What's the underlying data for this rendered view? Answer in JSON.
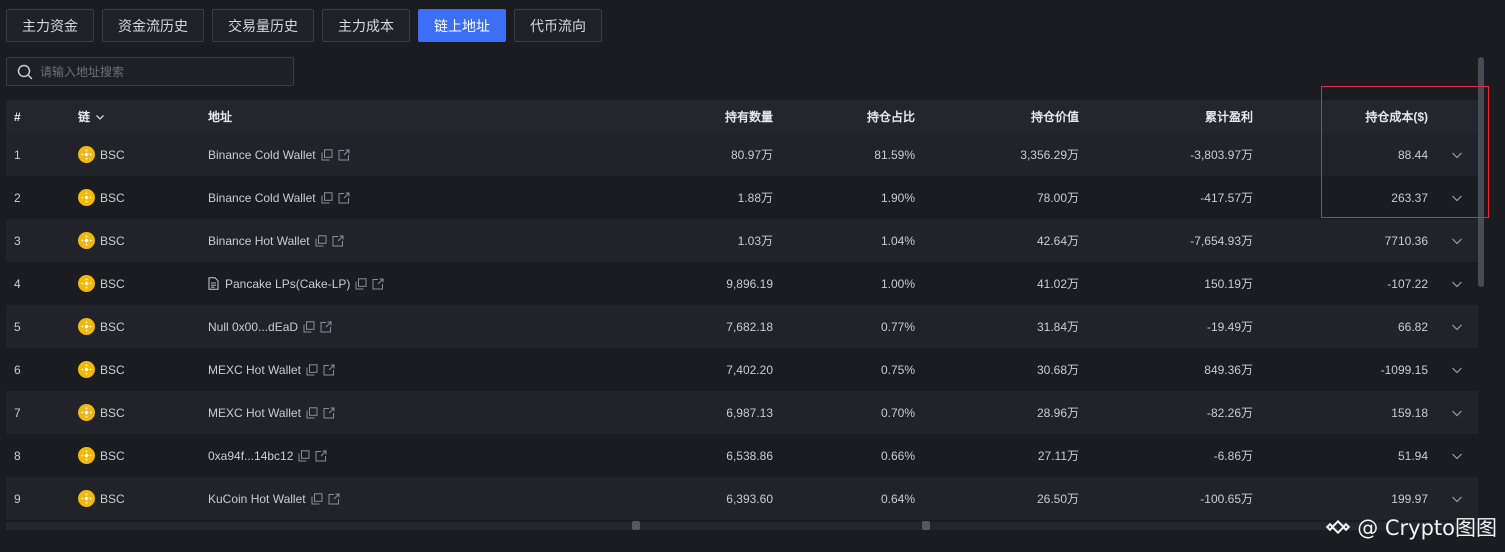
{
  "tabs": [
    {
      "label": "主力资金",
      "active": false
    },
    {
      "label": "资金流历史",
      "active": false
    },
    {
      "label": "交易量历史",
      "active": false
    },
    {
      "label": "主力成本",
      "active": false
    },
    {
      "label": "链上地址",
      "active": true
    },
    {
      "label": "代币流向",
      "active": false
    }
  ],
  "search": {
    "placeholder": "请输入地址搜索",
    "icon": "search-icon"
  },
  "table": {
    "headers": {
      "num": "#",
      "chain": "链",
      "address": "地址",
      "quantity": "持有数量",
      "percent": "持仓占比",
      "value": "持仓价值",
      "pnl": "累计盈利",
      "cost": "持仓成本($)"
    },
    "rows": [
      {
        "num": "1",
        "chain": "BSC",
        "address": "Binance Cold Wallet",
        "contract": false,
        "quantity": "80.97万",
        "percent": "81.59%",
        "value": "3,356.29万",
        "pnl": "-3,803.97万",
        "cost": "88.44"
      },
      {
        "num": "2",
        "chain": "BSC",
        "address": "Binance Cold Wallet",
        "contract": false,
        "quantity": "1.88万",
        "percent": "1.90%",
        "value": "78.00万",
        "pnl": "-417.57万",
        "cost": "263.37"
      },
      {
        "num": "3",
        "chain": "BSC",
        "address": "Binance Hot Wallet",
        "contract": false,
        "quantity": "1.03万",
        "percent": "1.04%",
        "value": "42.64万",
        "pnl": "-7,654.93万",
        "cost": "7710.36"
      },
      {
        "num": "4",
        "chain": "BSC",
        "address": "Pancake LPs(Cake-LP)",
        "contract": true,
        "quantity": "9,896.19",
        "percent": "1.00%",
        "value": "41.02万",
        "pnl": "150.19万",
        "cost": "-107.22"
      },
      {
        "num": "5",
        "chain": "BSC",
        "address": "Null 0x00...dEaD",
        "contract": false,
        "quantity": "7,682.18",
        "percent": "0.77%",
        "value": "31.84万",
        "pnl": "-19.49万",
        "cost": "66.82"
      },
      {
        "num": "6",
        "chain": "BSC",
        "address": "MEXC Hot Wallet",
        "contract": false,
        "quantity": "7,402.20",
        "percent": "0.75%",
        "value": "30.68万",
        "pnl": "849.36万",
        "cost": "-1099.15"
      },
      {
        "num": "7",
        "chain": "BSC",
        "address": "MEXC Hot Wallet",
        "contract": false,
        "quantity": "6,987.13",
        "percent": "0.70%",
        "value": "28.96万",
        "pnl": "-82.26万",
        "cost": "159.18"
      },
      {
        "num": "8",
        "chain": "BSC",
        "address": "0xa94f...14bc12",
        "contract": false,
        "quantity": "6,538.86",
        "percent": "0.66%",
        "value": "27.11万",
        "pnl": "-6.86万",
        "cost": "51.94"
      },
      {
        "num": "9",
        "chain": "BSC",
        "address": "KuCoin Hot Wallet",
        "contract": false,
        "quantity": "6,393.60",
        "percent": "0.64%",
        "value": "26.50万",
        "pnl": "-100.65万",
        "cost": "199.97"
      }
    ]
  },
  "watermark": {
    "text": "@ Crypto图图"
  },
  "colors": {
    "accent": "#3d6ff6",
    "highlight": "#e5283a",
    "bnb": "#f0b90b",
    "background": "#1b1c21"
  }
}
